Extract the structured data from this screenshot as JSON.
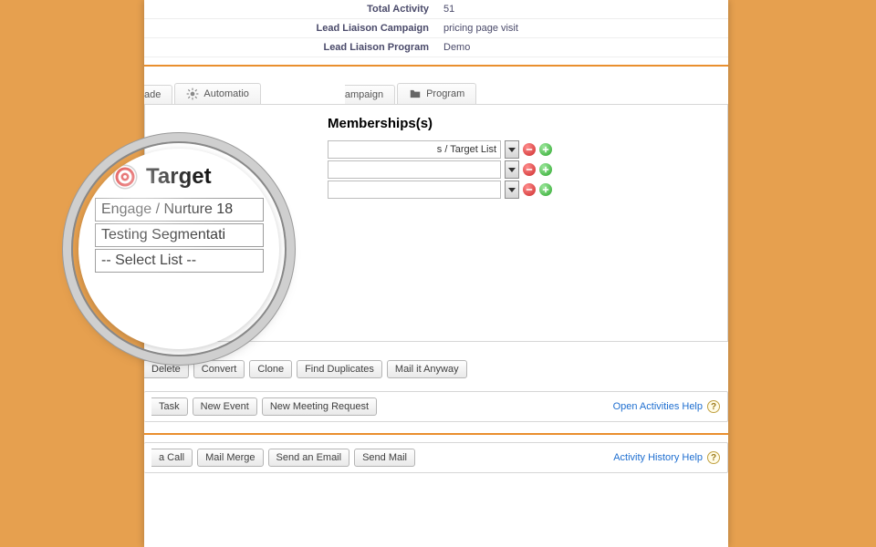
{
  "info": {
    "rows": [
      {
        "label": "Total Activity",
        "value": "51"
      },
      {
        "label": "Lead Liaison Campaign",
        "value": "pricing page visit"
      },
      {
        "label": "Lead Liaison Program",
        "value": "Demo"
      }
    ]
  },
  "tabs": {
    "items": [
      {
        "label": "ade",
        "icon": "grade"
      },
      {
        "label": "Automatio",
        "icon": "gear"
      },
      {
        "label": "ampaign",
        "icon": "campaign"
      },
      {
        "label": "Program",
        "icon": "folder"
      }
    ]
  },
  "memberships": {
    "heading": "Memberships(s)",
    "rows": [
      {
        "text": "s / Target List"
      },
      {
        "text": ""
      },
      {
        "text": ""
      }
    ]
  },
  "magnifier": {
    "title": "Target",
    "options": [
      "Engage / Nurture 18",
      "Testing Segmentati",
      "-- Select List --"
    ]
  },
  "actionButtons": {
    "row1": [
      "Delete",
      "Convert",
      "Clone",
      "Find Duplicates",
      "Mail it Anyway"
    ],
    "row2": {
      "buttons": [
        "Task",
        "New Event",
        "New Meeting Request"
      ],
      "help": "Open Activities Help"
    },
    "row3": {
      "buttons": [
        "a Call",
        "Mail Merge",
        "Send an Email",
        "Send Mail"
      ],
      "help": "Activity History Help"
    }
  }
}
